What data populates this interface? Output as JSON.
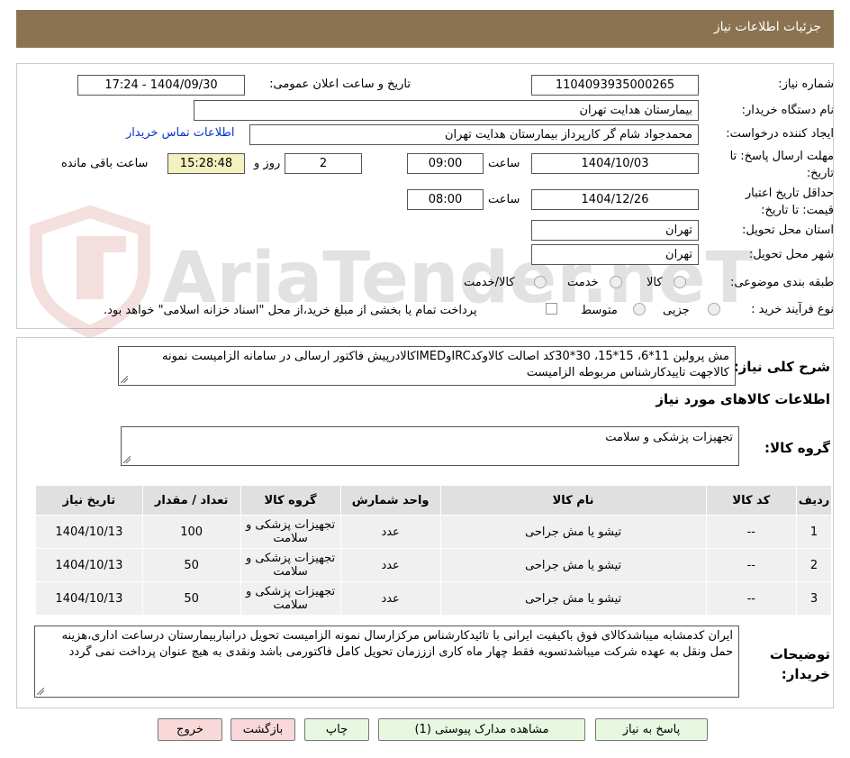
{
  "header": {
    "title": "جزئیات اطلاعات نیاز"
  },
  "form": {
    "need_number_label": "شماره نیاز:",
    "need_number": "1104093935000265",
    "announce_label": "تاریخ و ساعت اعلان عمومی:",
    "announce_value": "1404/09/30 - 17:24",
    "buyer_org_label": "نام دستگاه خریدار:",
    "buyer_org": "بیمارستان هدایت تهران",
    "requester_label": "ایجاد کننده درخواست:",
    "requester": "محمدجواد شام گر کارپرداز بیمارستان هدایت تهران",
    "contact_link": "اطلاعات تماس خریدار",
    "deadline_label": "مهلت ارسال پاسخ: تا تاریخ:",
    "deadline_date": "1404/10/03",
    "time_label": "ساعت",
    "deadline_time": "09:00",
    "days_value": "2",
    "days_label": "روز و",
    "remaining_time": "15:28:48",
    "remaining_label": "ساعت باقی مانده",
    "validity_label": "حداقل تاریخ اعتبار قیمت: تا تاریخ:",
    "validity_date": "1404/12/26",
    "validity_time": "08:00",
    "province_label": "استان محل تحویل:",
    "province": "تهران",
    "city_label": "شهر محل تحویل:",
    "city": "تهران",
    "category_label": "طبقه بندی موضوعی:",
    "category_options": [
      "کالا",
      "خدمت",
      "کالا/خدمت"
    ],
    "process_label": "نوع فرآیند خرید :",
    "process_options": [
      "جزیی",
      "متوسط"
    ],
    "payment_note": "پرداخت تمام یا بخشی از مبلغ خرید،از محل \"اسناد خزانه اسلامی\" خواهد بود."
  },
  "summary": {
    "label": "شرح کلی نیاز:",
    "text": "مش پرولین 11*6، 15*15، 30*30کد اصالت کالاوکدIRCوIMEDکالادرپیش فاکتور ارسالی در سامانه الزامیست نمونه کالاجهت تاییدکارشناس مربوطه الزامیست"
  },
  "items_section": {
    "title": "اطلاعات کالاهای مورد نیاز",
    "group_label": "گروه کالا:",
    "group_value": "تجهیزات پزشکی و سلامت"
  },
  "table": {
    "headers": [
      "ردیف",
      "کد کالا",
      "نام کالا",
      "واحد شمارش",
      "گروه کالا",
      "تعداد / مقدار",
      "تاریخ نیاز"
    ],
    "rows": [
      [
        "1",
        "--",
        "تیشو یا مش جراحی",
        "عدد",
        "تجهیزات پزشکی و سلامت",
        "100",
        "1404/10/13"
      ],
      [
        "2",
        "--",
        "تیشو یا مش جراحی",
        "عدد",
        "تجهیزات پزشکی و سلامت",
        "50",
        "1404/10/13"
      ],
      [
        "3",
        "--",
        "تیشو یا مش جراحی",
        "عدد",
        "تجهیزات پزشکی و سلامت",
        "50",
        "1404/10/13"
      ]
    ]
  },
  "buyer_notes": {
    "label": "توضیحات خریدار:",
    "text": "ایران کدمشابه میباشدکالای فوق باکیفیت ایرانی با تائیدکارشناس مرکزارسال نمونه الزامیست تحویل درانباربیمارستان درساعت اداری،هزینه حمل ونقل به عهده شرکت میباشدتسویه فقط چهار ماه کاری ازززمان تحویل کامل فاکتورمی باشد ونقدی به هیچ عنوان پرداخت نمی گردد"
  },
  "buttons": {
    "reply": "پاسخ به نیاز",
    "attachments": "مشاهده مدارک پیوستی (1)",
    "print": "چاپ",
    "back": "بازگشت",
    "exit": "خروج"
  },
  "watermark": "AriaTender.neT",
  "colors": {
    "header_bg": "#8b7351",
    "remaining_bg": "#f5f0c0",
    "link": "#0033cc",
    "back_btn": "#f8d8d8",
    "action_btn": "#e8f8e0"
  }
}
